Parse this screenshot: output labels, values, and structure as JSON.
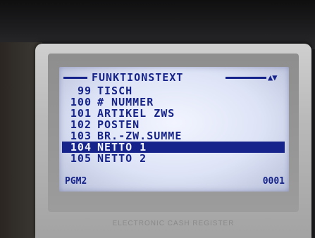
{
  "screen": {
    "title": "FUNKTIONSTEXT",
    "scroll_indicator": "▲▼",
    "items": [
      {
        "num": "99",
        "label": "TISCH"
      },
      {
        "num": "100",
        "label": "# NUMMER"
      },
      {
        "num": "101",
        "label": "ARTIKEL ZWS"
      },
      {
        "num": "102",
        "label": "POSTEN"
      },
      {
        "num": "103",
        "label": "BR.-ZW.SUMME"
      },
      {
        "num": "104",
        "label": "NETTO 1"
      },
      {
        "num": "105",
        "label": "NETTO 2"
      }
    ],
    "selected_index": 5,
    "mode": "PGM2",
    "counter": "0001"
  },
  "device": {
    "brand_text": "ELECTRONIC CASH REGISTER"
  },
  "colors": {
    "lcd_text": "#16238a",
    "lcd_background": "#e6ebfa",
    "highlight_background": "#16238a",
    "highlight_text": "#f2f5ff"
  }
}
